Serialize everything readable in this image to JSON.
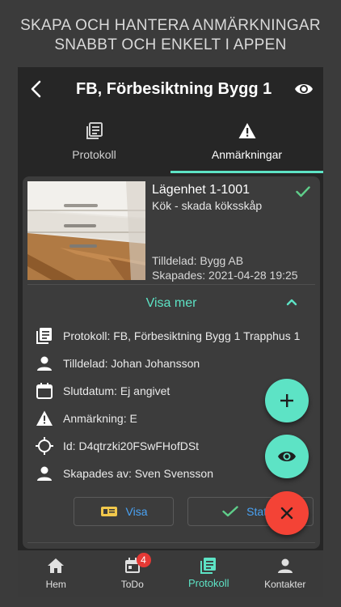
{
  "promo": {
    "line1": "SKAPA OCH HANTERA ANMÄRKNINGAR",
    "line2": "SNABBT OCH ENKELT I APPEN"
  },
  "appbar": {
    "title": "FB, Förbesiktning Bygg 1",
    "back_icon": "chevron-left-icon",
    "eye_icon": "eye-icon"
  },
  "tabs": [
    {
      "label": "Protokoll",
      "icon": "document-list-icon",
      "active": false
    },
    {
      "label": "Anmärkningar",
      "icon": "warning-icon",
      "active": true
    }
  ],
  "remark": {
    "title": "Lägenhet 1-1001",
    "subtitle": "Kök - skada köksskåp",
    "assigned": "Tilldelad: Bygg AB",
    "created": "Skapades: 2021-04-28 19:25",
    "status_icon": "check-icon"
  },
  "visa_mer": "Visa mer",
  "details": [
    {
      "icon": "document-list-icon",
      "text": "Protokoll: FB, Förbesiktning Bygg 1 Trapphus 1"
    },
    {
      "icon": "person-icon",
      "text": "Tilldelad: Johan  Johansson"
    },
    {
      "icon": "calendar-icon",
      "text": "Slutdatum: Ej angivet"
    },
    {
      "icon": "warning-icon",
      "text": "Anmärkning: E"
    },
    {
      "icon": "crosshair-icon",
      "text": "Id: D4qtrzki20FSwFHofDSt"
    },
    {
      "icon": "person-icon",
      "text": "Skapades av: Sven  Svensson"
    }
  ],
  "buttons": {
    "visa": "Visa",
    "status": "Status"
  },
  "fabs": [
    {
      "icon": "plus-icon",
      "color": "#5de3c5"
    },
    {
      "icon": "eye-icon",
      "color": "#5de3c5"
    },
    {
      "icon": "close-icon",
      "color": "#f44336"
    }
  ],
  "nav": [
    {
      "label": "Hem",
      "icon": "home-icon",
      "active": false
    },
    {
      "label": "ToDo",
      "icon": "calendar-icon",
      "badge": "4",
      "active": false
    },
    {
      "label": "Protokoll",
      "icon": "document-list-icon",
      "active": true
    },
    {
      "label": "Kontakter",
      "icon": "person-icon",
      "active": false
    }
  ],
  "colors": {
    "accent": "#5de3c5",
    "danger": "#f44336",
    "link": "#4aa3f5",
    "background": "#262626"
  }
}
